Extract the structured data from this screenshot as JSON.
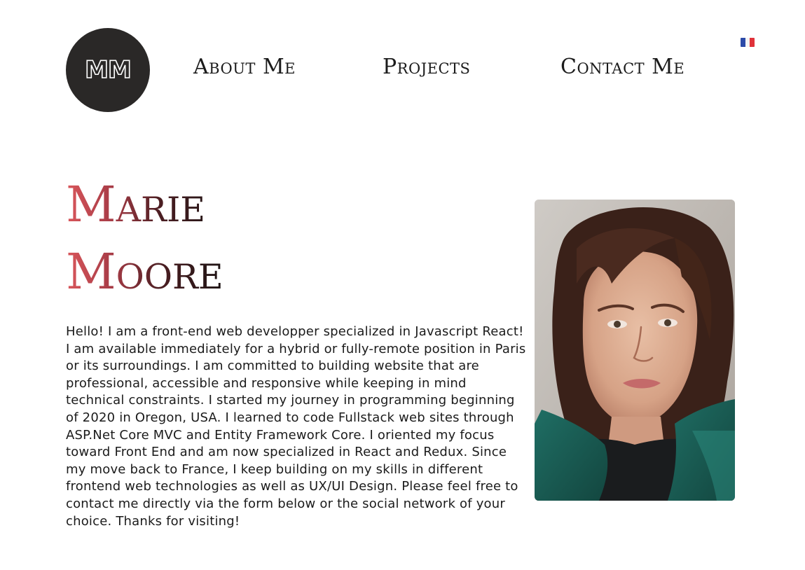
{
  "header": {
    "logo_text": "MM",
    "nav": {
      "about": "About Me",
      "projects": "Projects",
      "contact": "Contact Me"
    },
    "language_flag": "france-flag-icon"
  },
  "hero": {
    "name_first": "Marie",
    "name_last": "Moore",
    "bio": "Hello! I am a front-end web developper specialized in Javascript React! I am available immediately for a hybrid or fully-remote position in Paris or its surroundings. I am committed to building website that are professional, accessible and responsive while keeping in mind technical constraints. I started my journey in programming beginning of 2020 in Oregon, USA. I learned to code Fullstack web sites through ASP.Net Core MVC and Entity Framework Core. I oriented my focus toward Front End and am now specialized in React and Redux. Since my move back to France, I keep building on my skills in different frontend web technologies as well as UX/UI Design. Please feel free to contact me directly via the form below or the social network of your choice. Thanks for visiting!"
  },
  "colors": {
    "logo_bg": "#2a2827",
    "name_gradient_start": "#d9565b",
    "name_gradient_end": "#1d1414",
    "text": "#1b1b1b"
  }
}
